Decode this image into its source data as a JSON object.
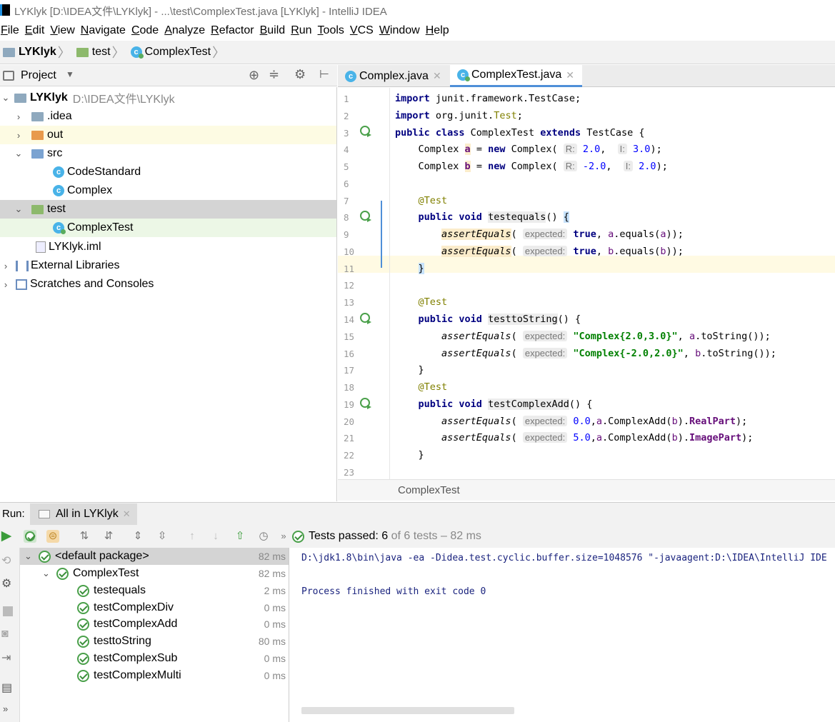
{
  "window": {
    "title": "LYKlyk [D:\\IDEA文件\\LYKlyk] - ...\\test\\ComplexTest.java [LYKlyk] - IntelliJ IDEA"
  },
  "menu": [
    "File",
    "Edit",
    "View",
    "Navigate",
    "Code",
    "Analyze",
    "Refactor",
    "Build",
    "Run",
    "Tools",
    "VCS",
    "Window",
    "Help"
  ],
  "breadcrumb": {
    "project": "LYKlyk",
    "folder": "test",
    "file": "ComplexTest"
  },
  "project_panel": {
    "title": "Project",
    "tree": [
      {
        "label": "LYKlyk",
        "path": "D:\\IDEA文件\\LYKlyk"
      },
      {
        "label": ".idea"
      },
      {
        "label": "out"
      },
      {
        "label": "src"
      },
      {
        "label": "CodeStandard"
      },
      {
        "label": "Complex"
      },
      {
        "label": "test"
      },
      {
        "label": "ComplexTest"
      },
      {
        "label": "LYKlyk.iml"
      },
      {
        "label": "External Libraries"
      },
      {
        "label": "Scratches and Consoles"
      }
    ]
  },
  "editor": {
    "tabs": [
      {
        "label": "Complex.java"
      },
      {
        "label": "ComplexTest.java"
      }
    ],
    "footer": "ComplexTest",
    "line_numbers": [
      "1",
      "2",
      "3",
      "4",
      "5",
      "6",
      "7",
      "8",
      "9",
      "10",
      "11",
      "12",
      "13",
      "14",
      "15",
      "16",
      "17",
      "18",
      "19",
      "20",
      "21",
      "22",
      "23"
    ]
  },
  "run": {
    "label": "Run:",
    "tab": "All in LYKlyk",
    "status_prefix": "Tests passed: ",
    "status_count": "6",
    "status_suffix": " of 6 tests – 82 ms",
    "tests": [
      {
        "name": "<default package>",
        "time": "82 ms"
      },
      {
        "name": "ComplexTest",
        "time": "82 ms"
      },
      {
        "name": "testequals",
        "time": "2 ms"
      },
      {
        "name": "testComplexDiv",
        "time": "0 ms"
      },
      {
        "name": "testComplexAdd",
        "time": "0 ms"
      },
      {
        "name": "testtoString",
        "time": "80 ms"
      },
      {
        "name": "testComplexSub",
        "time": "0 ms"
      },
      {
        "name": "testComplexMulti",
        "time": "0 ms"
      }
    ],
    "console": [
      "D:\\jdk1.8\\bin\\java -ea -Didea.test.cyclic.buffer.size=1048576 \"-javaagent:D:\\IDEA\\IntelliJ IDE",
      "Process finished with exit code 0"
    ]
  },
  "colors": {
    "passed": "#4aa04a",
    "selection": "#d4d4d4",
    "current_line": "#fffae3",
    "accent": "#1e8fe0"
  }
}
